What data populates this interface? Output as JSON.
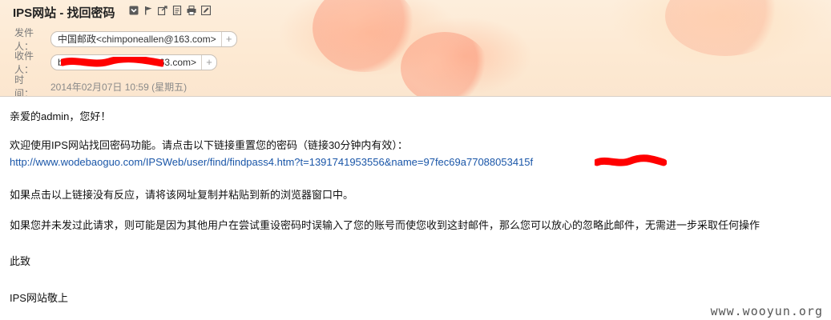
{
  "header": {
    "subject": "IPS网站 - 找回密码",
    "toolbar_icons": [
      "mark-icon",
      "flag-icon",
      "move-icon",
      "note-icon",
      "print-icon",
      "edit-icon"
    ],
    "from": {
      "label": "发件人：",
      "address": "中国邮政<chimponeallen@163.com>",
      "add_label": "+"
    },
    "to": {
      "label": "收件人：",
      "address": "b                                  163.com>",
      "add_label": "+"
    },
    "time": {
      "label": "时　间：",
      "value": "2014年02月07日 10:59 (星期五)"
    }
  },
  "body": {
    "greeting": "亲爱的admin，您好！",
    "intro": "欢迎使用IPS网站找回密码功能。请点击以下链接重置您的密码（链接30分钟内有效）：",
    "link": "http://www.wodebaoguo.com/IPSWeb/user/find/findpass4.htm?t=1391741953556&name=97fec69a77088053415f",
    "fail_note": "如果点击以上链接没有反应，请将该网址复制并粘贴到新的浏览器窗口中。",
    "ignore_note": "如果您并未发过此请求，则可能是因为其他用户在尝试重设密码时误输入了您的账号而使您收到这封邮件，那么您可以放心的忽略此邮件，无需进一步采取任何操作",
    "regards": "此致",
    "signature": "IPS网站敬上"
  },
  "watermark": "www.wooyun.org",
  "colors": {
    "link": "#1a56a8",
    "redaction": "#ff0000"
  }
}
